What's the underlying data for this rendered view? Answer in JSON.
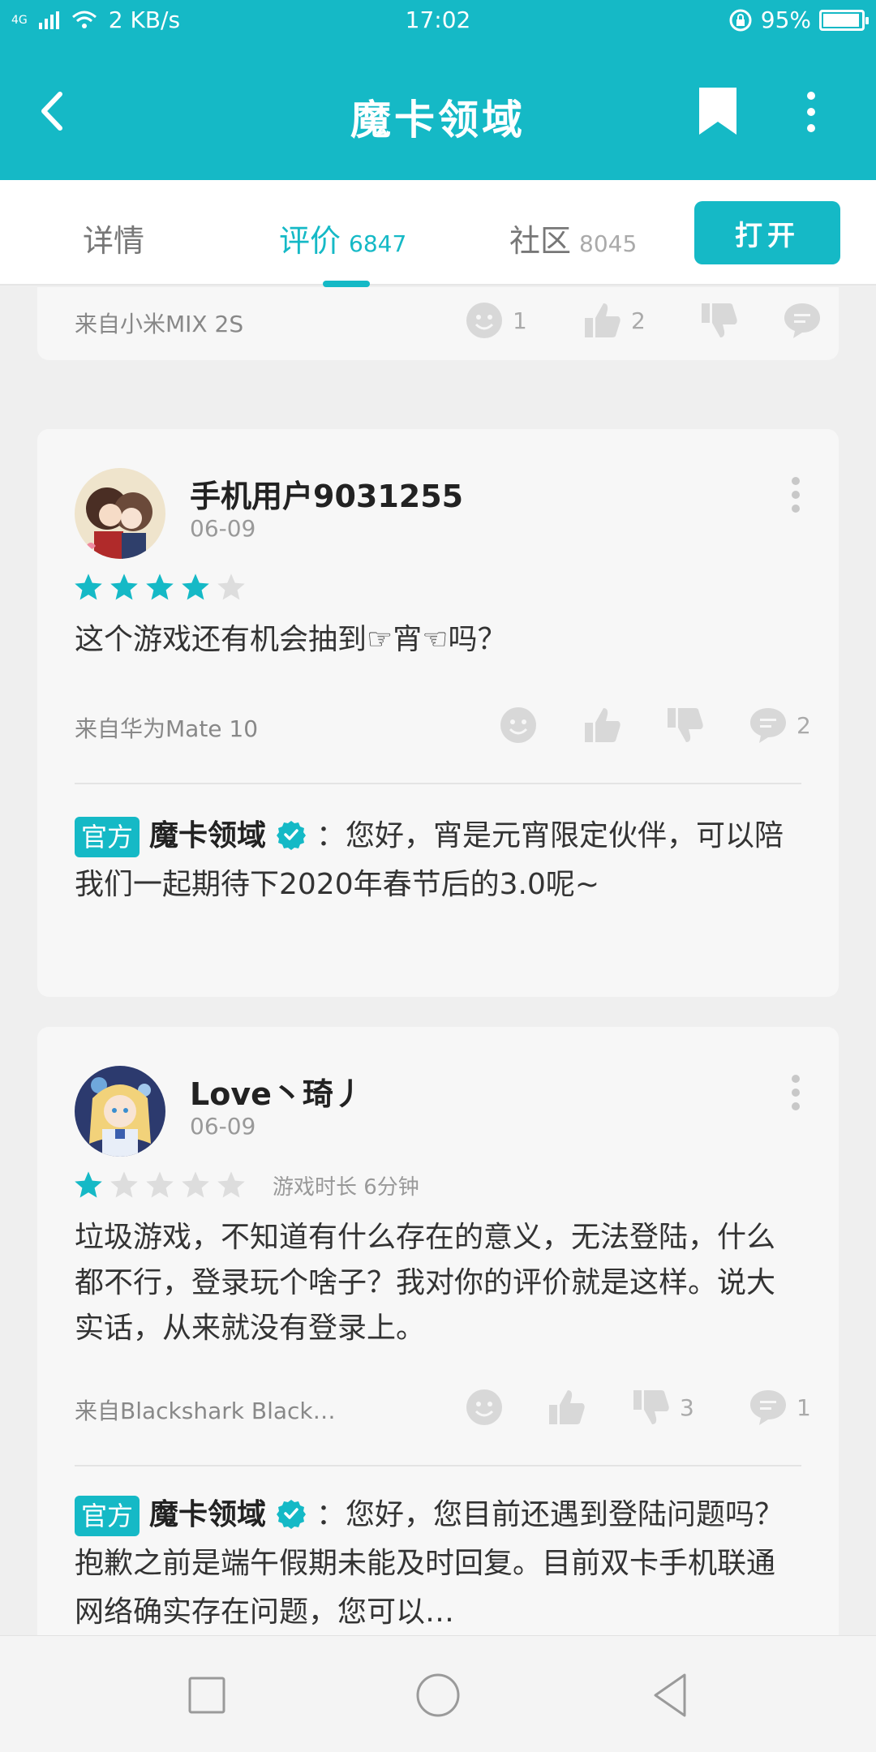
{
  "status_bar": {
    "network": "4G",
    "speed": "2 KB/s",
    "time": "17:02",
    "battery": "95%"
  },
  "app_bar": {
    "title": "魔卡领域"
  },
  "tabs": [
    {
      "label": "详情",
      "count": ""
    },
    {
      "label": "评价",
      "count": "6847"
    },
    {
      "label": "社区",
      "count": "8045"
    }
  ],
  "open_button": "打开",
  "partial_review": {
    "device": "来自小米MIX 2S",
    "smile_count": "1",
    "like_count": "2",
    "dislike_count": "",
    "comment_count": ""
  },
  "reviews": [
    {
      "username": "手机用户9031255",
      "date": "06-09",
      "rating": 4,
      "play_time": "",
      "content": "这个游戏还有机会抽到☞宵☜吗？",
      "device": "来自华为Mate 10",
      "smile_count": "",
      "like_count": "",
      "dislike_count": "",
      "comment_count": "2",
      "reply": {
        "badge": "官方",
        "name": "魔卡领域",
        "text": "：您好，宵是元宵限定伙伴，可以陪我们一起期待下2020年春节后的3.0呢~"
      }
    },
    {
      "username": "Love丶琦丿",
      "date": "06-09",
      "rating": 1,
      "play_time": "游戏时长 6分钟",
      "content": "垃圾游戏，不知道有什么存在的意义，无法登陆，什么都不行，登录玩个啥子？我对你的评价就是这样。说大实话，从来就没有登录上。",
      "device": "来自Blackshark Black…",
      "smile_count": "",
      "like_count": "",
      "dislike_count": "3",
      "comment_count": "1",
      "reply": {
        "badge": "官方",
        "name": "魔卡领域",
        "text": "：您好，您目前还遇到登陆问题吗？抱歉之前是端午假期未能及时回复。目前双卡手机联通网络确实存在问题，您可以…"
      }
    }
  ],
  "colors": {
    "accent": "#15b9c6",
    "star_on": "#15b9c6",
    "star_off": "#dddddd"
  }
}
